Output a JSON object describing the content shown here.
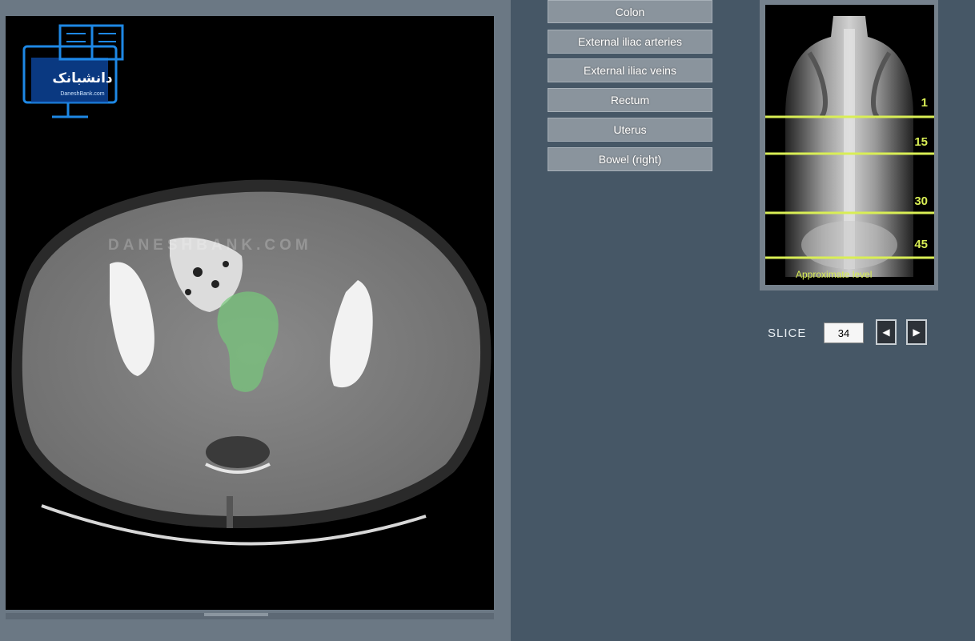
{
  "viewer": {
    "watermark": "DANESHBANK.COM",
    "logo": {
      "text": "دانشبانک",
      "subtext": "DaneshBank.com"
    },
    "overlay_color": "#76c97a"
  },
  "menu": {
    "items": [
      {
        "label": "Colon"
      },
      {
        "label": "External iliac arteries"
      },
      {
        "label": "External iliac veins"
      },
      {
        "label": "Rectum"
      },
      {
        "label": "Uterus"
      },
      {
        "label": "Bowel (right)"
      }
    ]
  },
  "scout": {
    "levels": [
      "1",
      "15",
      "30",
      "45"
    ],
    "caption": "Approximate level",
    "line_color": "#d9ee55"
  },
  "slice": {
    "label": "SLICE",
    "value": "34",
    "prev_icon": "prev-slice-icon",
    "next_icon": "next-slice-icon"
  }
}
